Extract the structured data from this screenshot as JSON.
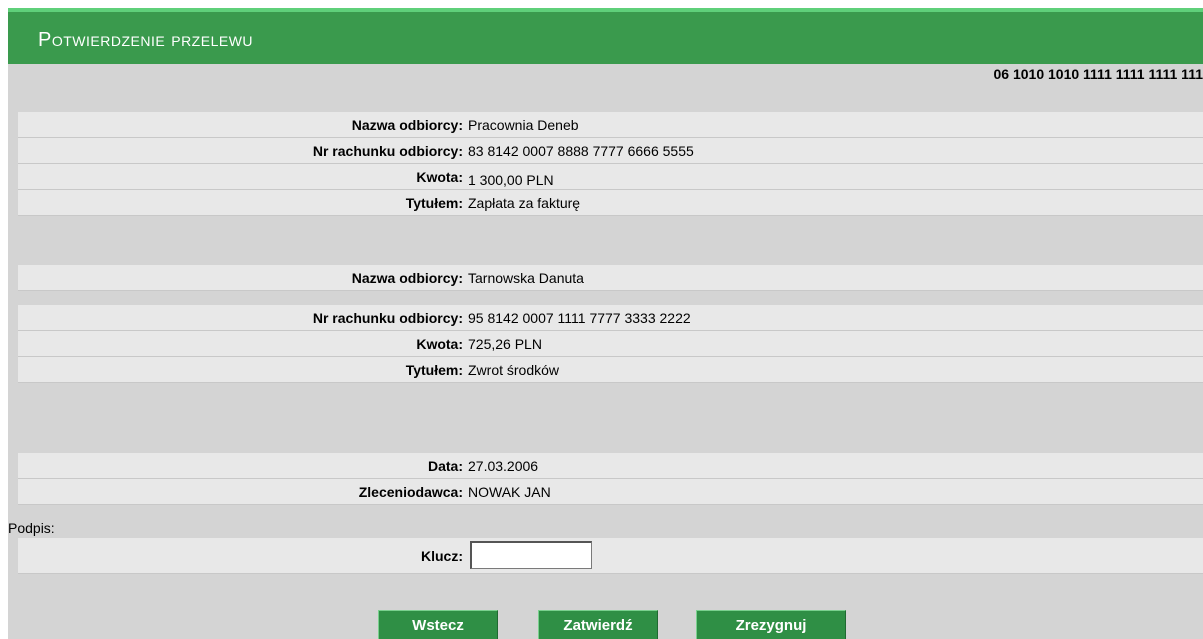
{
  "header": {
    "title": "Potwierdzenie przelewu",
    "account": "06 1010 1010 1111 1111 1111 111"
  },
  "transfers": [
    {
      "recipient_name_label": "Nazwa odbiorcy:",
      "recipient_name": "Pracownia Deneb",
      "account_label": "Nr rachunku odbiorcy:",
      "account": "83 8142 0007 8888 7777 6666 5555",
      "amount_label": "Kwota:",
      "amount": "1 300,00 PLN",
      "title_label": "Tytułem:",
      "title": "Zapłata za fakturę"
    },
    {
      "recipient_name_label": "Nazwa odbiorcy:",
      "recipient_name": "Tarnowska Danuta",
      "account_label": "Nr rachunku odbiorcy:",
      "account": "95 8142 0007 1111 7777 3333 2222",
      "amount_label": "Kwota:",
      "amount": "725,26 PLN",
      "title_label": "Tytułem:",
      "title": "Zwrot środków"
    }
  ],
  "summary": {
    "date_label": "Data:",
    "date": "27.03.2006",
    "ordering_label": "Zleceniodawca:",
    "ordering": "NOWAK JAN"
  },
  "signature": {
    "label": "Podpis:",
    "key_label": "Klucz:",
    "key_value": ""
  },
  "buttons": {
    "back": "Wstecz",
    "confirm": "Zatwierdź",
    "cancel": "Zrezygnuj"
  }
}
